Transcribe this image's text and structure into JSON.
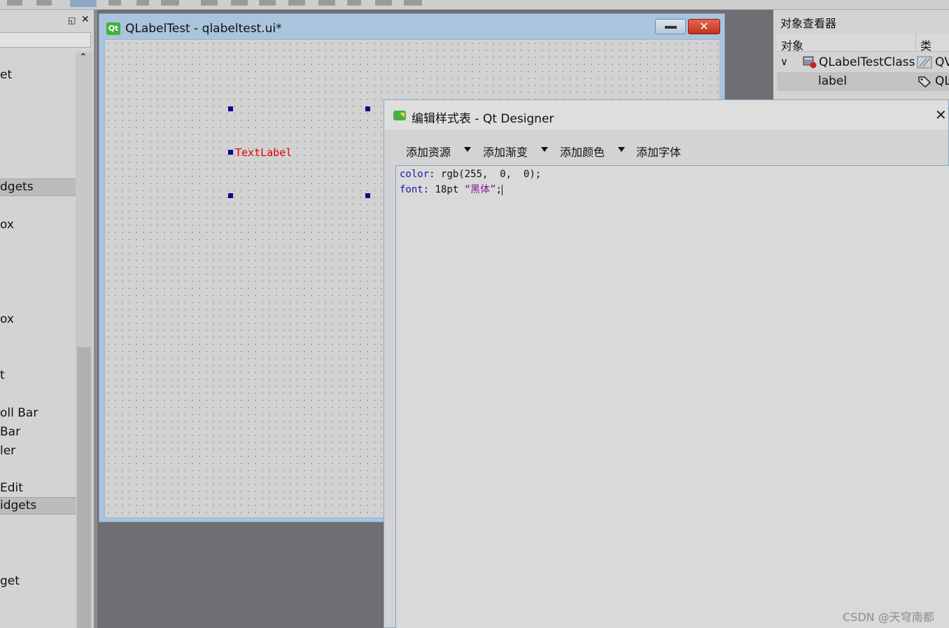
{
  "widget_box": {
    "items": [
      "et",
      "ox",
      "ox",
      "t",
      "oll Bar",
      "Bar",
      "ler",
      " Edit",
      "get"
    ],
    "categories": [
      "dgets",
      "idgets"
    ]
  },
  "form_window": {
    "title": "QLabelTest - qlabeltest.ui*",
    "qt_icon_text": "Qt",
    "label_text": "TextLabel",
    "close_glyph": "✕"
  },
  "object_inspector": {
    "title": "对象查看器",
    "col_object": "对象",
    "col_class": "类",
    "rows": [
      {
        "name": "QLabelTestClass",
        "class": "QV"
      },
      {
        "name": "label",
        "class": "QL"
      }
    ]
  },
  "style_dialog": {
    "title": "编辑样式表 - Qt Designer",
    "close_glyph": "✕",
    "toolbar": [
      "添加资源",
      "添加渐变",
      "添加颜色",
      "添加字体"
    ],
    "code": {
      "line1_prop": "color",
      "line1_value": ": rgb(255,  0,  0);",
      "line2_prop": "font",
      "line2_value": ": 18pt ",
      "line2_string": "“黑体”",
      "line2_end": ";"
    }
  },
  "watermark": "CSDN @天穹南都",
  "colors": {
    "label_red": "#e00000",
    "selection_handle": "#0a0a8a",
    "keyword_blue": "#1a1aa6",
    "string_purple": "#8a1a8a"
  }
}
